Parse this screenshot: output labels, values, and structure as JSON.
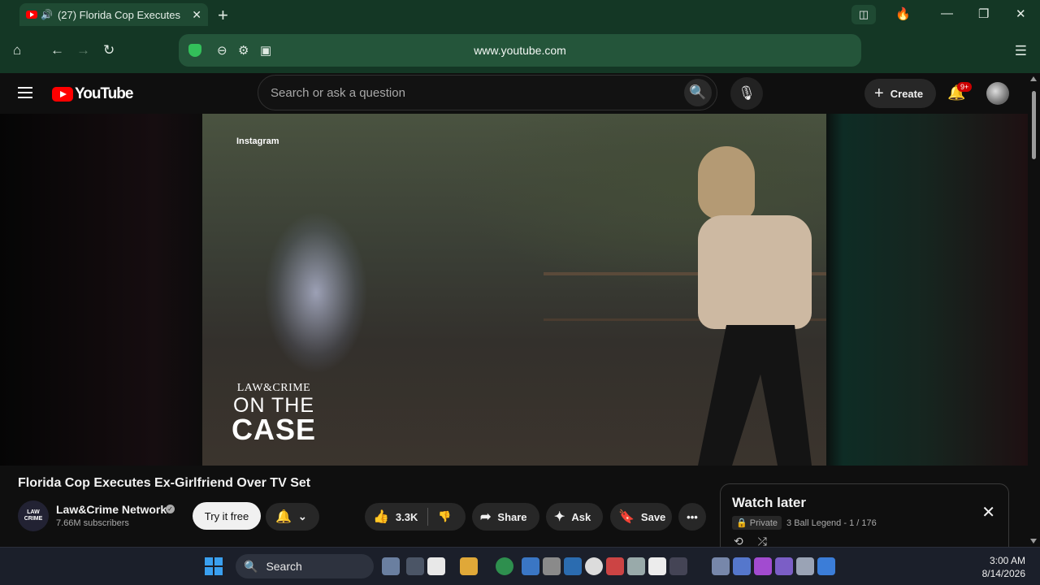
{
  "browser": {
    "tab_title": "(27) Florida Cop Executes",
    "url": "www.youtube.com"
  },
  "youtube": {
    "logo_text": "YouTube",
    "search_placeholder": "Search or ask a question",
    "create_label": "Create",
    "notifications_badge": "9+"
  },
  "video": {
    "overlay_source": "Instagram",
    "brand_line1": "LAW&CRIME",
    "brand_line2": "ON THE",
    "brand_line3": "CASE",
    "title": "Florida Cop Executes Ex-Girlfriend Over TV Set"
  },
  "channel": {
    "avatar_text": "LAW CRIME",
    "name": "Law&Crime Network",
    "subscribers": "7.66M subscribers",
    "try_label": "Try it free"
  },
  "actions": {
    "likes": "3.3K",
    "share_label": "Share",
    "ask_label": "Ask",
    "save_label": "Save"
  },
  "watch_later": {
    "title": "Watch later",
    "privacy": "Private",
    "progress": "3 Ball Legend - 1 / 176"
  },
  "taskbar": {
    "search_label": "Search",
    "time": "3:00 AM",
    "date": "8/14/2026"
  },
  "colors": {
    "browser_chrome": "#143725",
    "youtube_bg": "#0f0f0f",
    "youtube_red": "#ff0000",
    "taskbar": "#1b1f2a"
  }
}
